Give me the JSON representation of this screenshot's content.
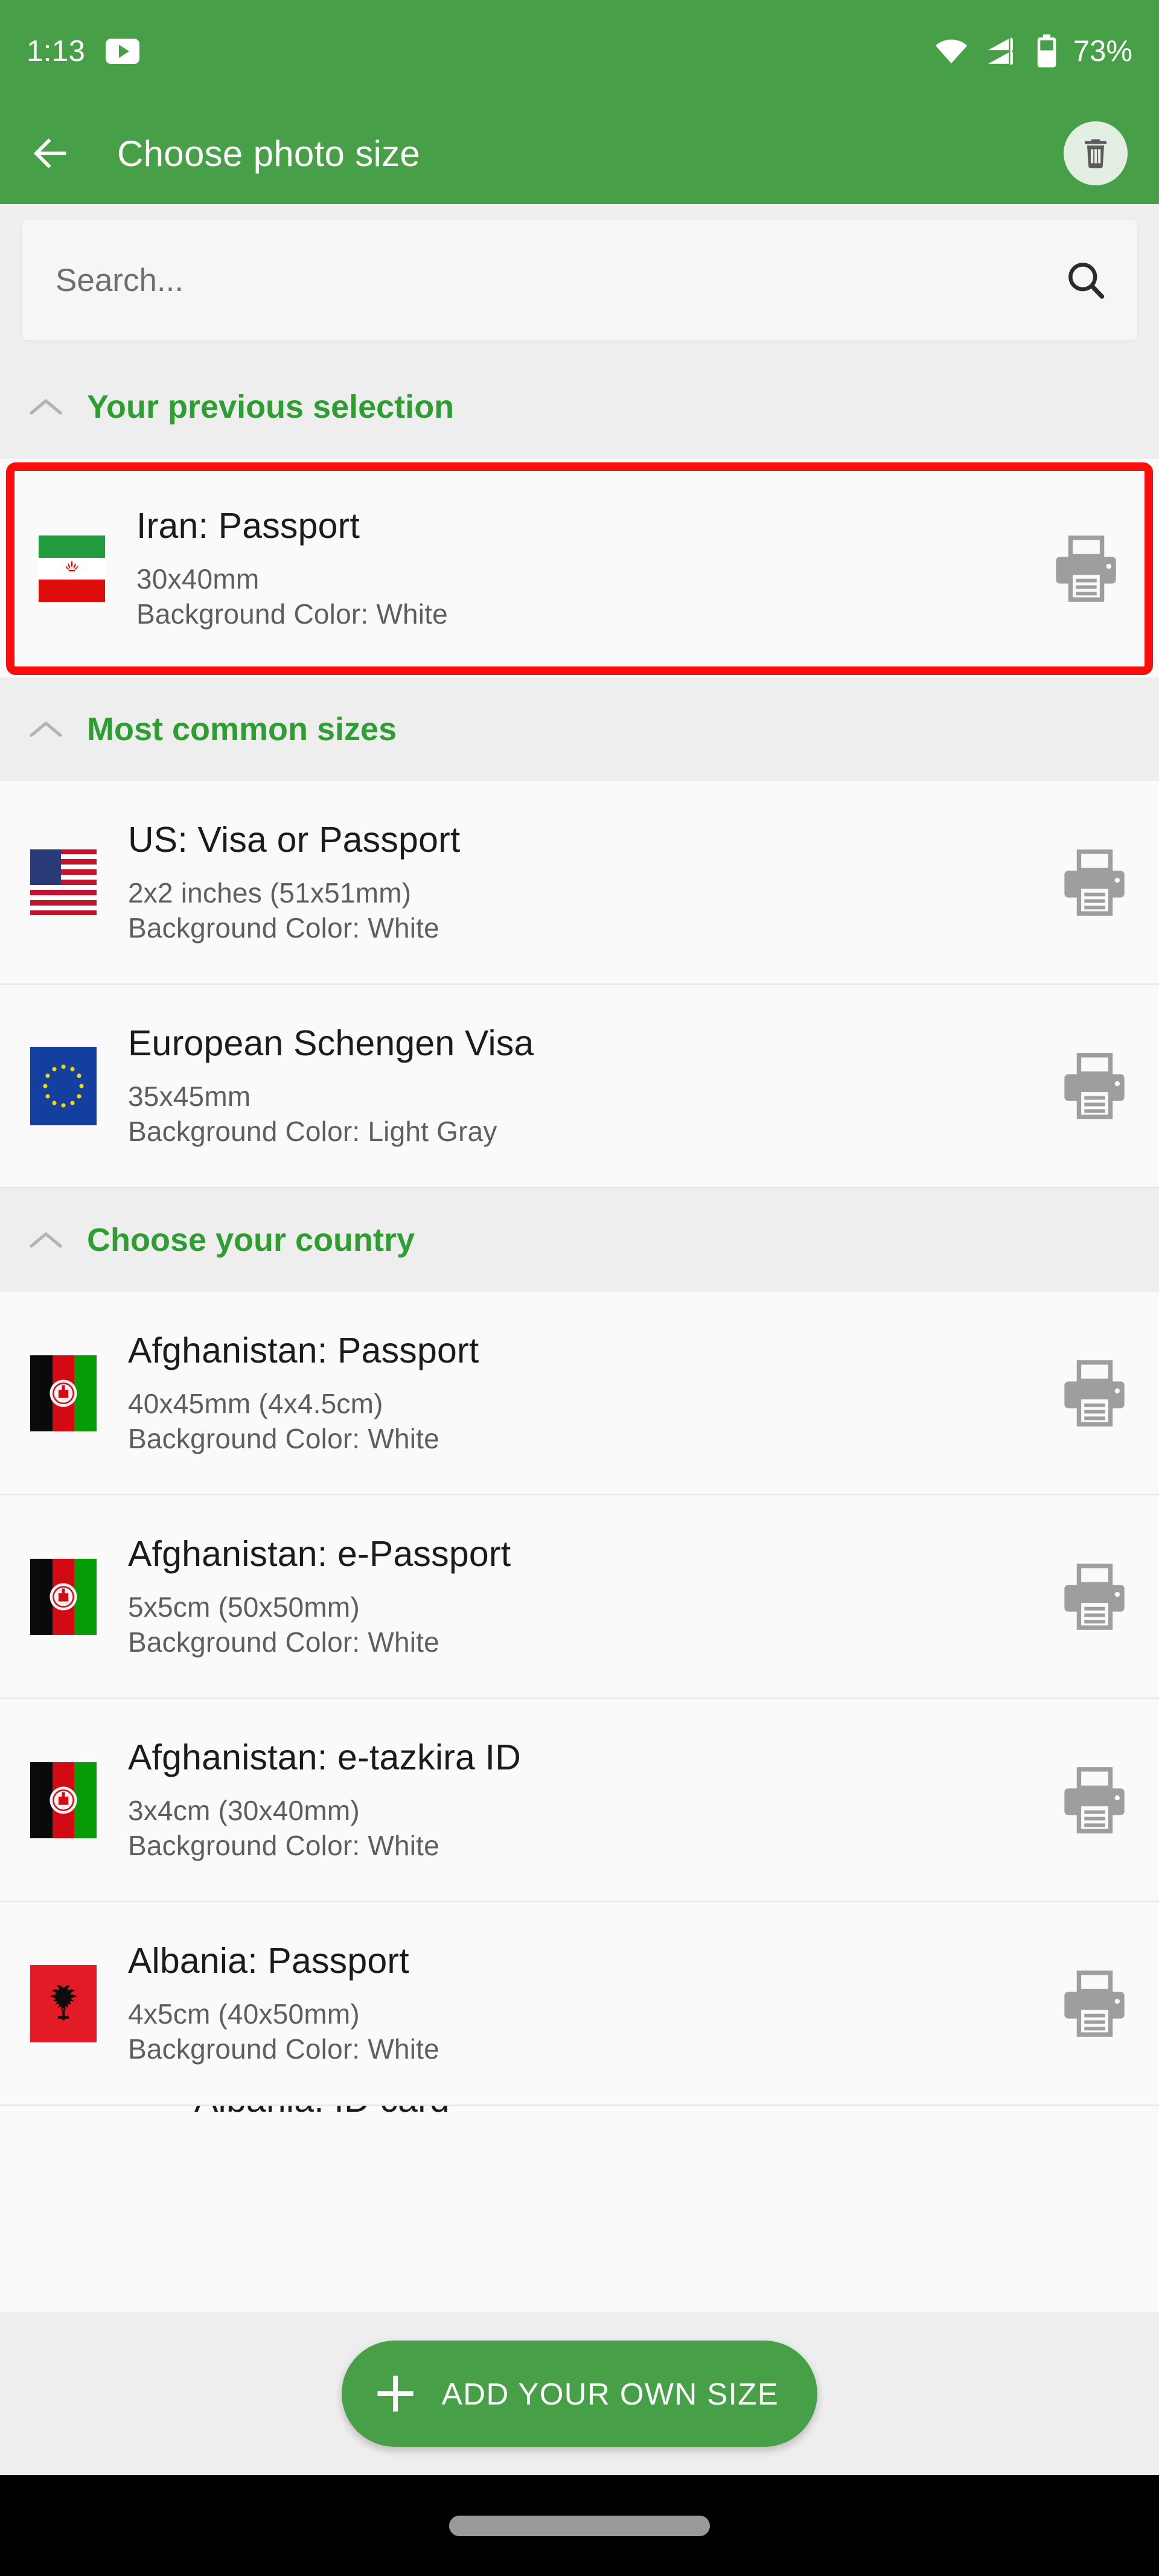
{
  "status_bar": {
    "clock": "1:13",
    "battery_percent": "73%",
    "icons": [
      "youtube-icon",
      "wifi-icon",
      "cellular-signal-icon",
      "battery-icon"
    ]
  },
  "app_bar": {
    "title": "Choose photo size",
    "back_label": "back-arrow-icon",
    "delete_label": "trash-icon",
    "background_color": "#47a047"
  },
  "search": {
    "placeholder": "Search...",
    "value": "",
    "icon": "search-icon"
  },
  "sections": [
    {
      "id": "previous-selection",
      "title": "Your previous selection",
      "collapsed": false,
      "chevron": "chevron-up-icon",
      "items": [
        {
          "title": "Iran: Passport",
          "size": "30x40mm",
          "background": "Background Color: White",
          "flag": "iran-flag",
          "action_icon": "printer-icon",
          "highlighted": true
        }
      ]
    },
    {
      "id": "most-common-sizes",
      "title": "Most common sizes",
      "collapsed": false,
      "chevron": "chevron-up-icon",
      "items": [
        {
          "title": "US: Visa or Passport",
          "size": "2x2 inches (51x51mm)",
          "background": "Background Color: White",
          "flag": "us-flag",
          "action_icon": "printer-icon",
          "highlighted": false
        },
        {
          "title": "European Schengen Visa",
          "size": "35x45mm",
          "background": "Background Color: Light Gray",
          "flag": "eu-flag",
          "action_icon": "printer-icon",
          "highlighted": false
        }
      ]
    },
    {
      "id": "choose-your-country",
      "title": "Choose your country",
      "collapsed": false,
      "chevron": "chevron-up-icon",
      "items": [
        {
          "title": "Afghanistan: Passport",
          "size": "40x45mm (4x4.5cm)",
          "background": "Background Color: White",
          "flag": "afghanistan-flag",
          "action_icon": "printer-icon",
          "highlighted": false
        },
        {
          "title": "Afghanistan: e-Passport",
          "size": "5x5cm (50x50mm)",
          "background": "Background Color: White",
          "flag": "afghanistan-flag",
          "action_icon": "printer-icon",
          "highlighted": false
        },
        {
          "title": "Afghanistan: e-tazkira ID",
          "size": "3x4cm (30x40mm)",
          "background": "Background Color: White",
          "flag": "afghanistan-flag",
          "action_icon": "printer-icon",
          "highlighted": false
        },
        {
          "title": "Albania: Passport",
          "size": "4x5cm (40x50mm)",
          "background": "Background Color: White",
          "flag": "albania-flag",
          "action_icon": "printer-icon",
          "highlighted": false
        }
      ]
    }
  ],
  "partial_row": {
    "title": "Albania: ID card"
  },
  "fab": {
    "label": "ADD YOUR OWN SIZE",
    "icon": "plus-icon",
    "color": "#47a047"
  },
  "nav_bar": {
    "gesture_pill": "home-gesture-pill"
  },
  "annotation": {
    "highlight_color": "#fb0d0d",
    "target": "Iran: Passport"
  },
  "theme": {
    "green": "#47a047",
    "section_header_green": "#2f9e32",
    "row_bg": "#fafafa",
    "section_bg": "#eeeeee"
  }
}
